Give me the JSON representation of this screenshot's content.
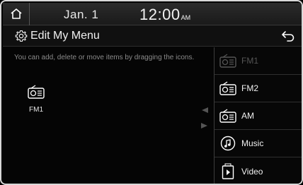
{
  "status_bar": {
    "date": "Jan.  1",
    "time": "12:00",
    "ampm": "AM"
  },
  "header": {
    "title": "Edit My Menu"
  },
  "hint_text": "You can add, delete or move items by dragging the icons.",
  "my_menu_items": [
    {
      "label": "FM1",
      "icon": "radio-icon"
    }
  ],
  "available_items": [
    {
      "label": "FM1",
      "icon": "radio-icon",
      "disabled": true
    },
    {
      "label": "FM2",
      "icon": "radio-icon",
      "disabled": false
    },
    {
      "label": "AM",
      "icon": "radio-icon",
      "disabled": false
    },
    {
      "label": "Music",
      "icon": "music-note-icon",
      "disabled": false
    },
    {
      "label": "Video",
      "icon": "video-icon",
      "disabled": false
    }
  ],
  "colors": {
    "background": "#000000",
    "text": "#ffffff",
    "hint": "#8a8a8a",
    "disabled": "#555555"
  }
}
